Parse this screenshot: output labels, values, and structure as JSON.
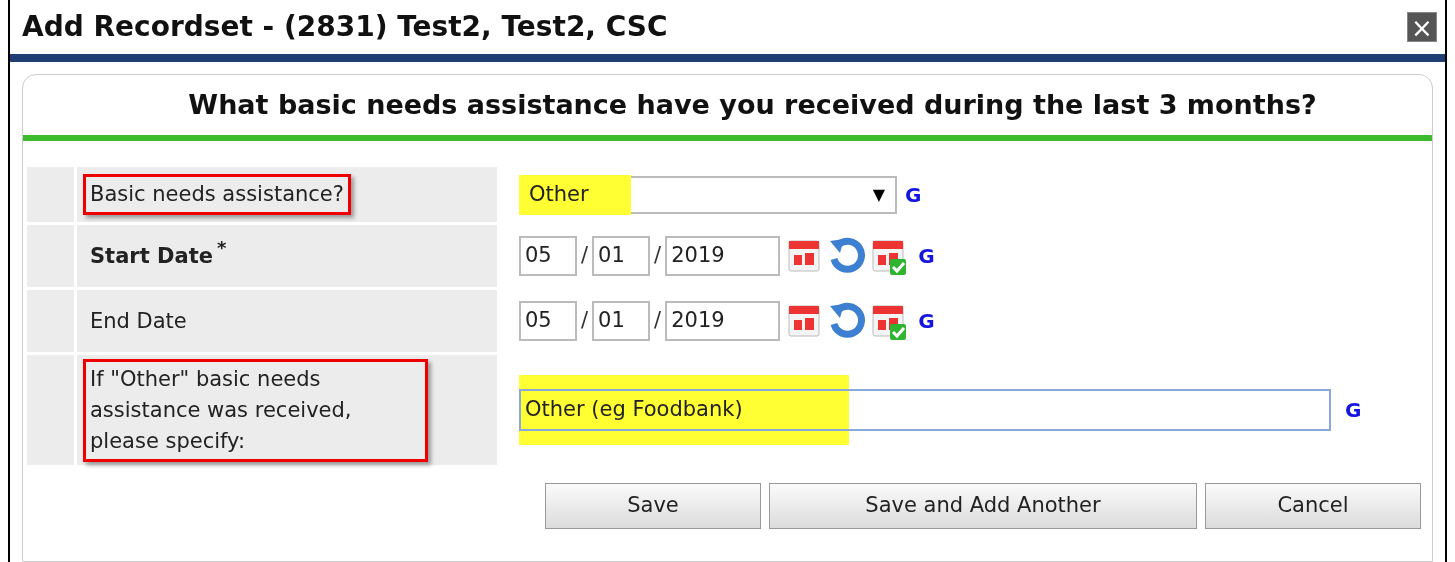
{
  "window": {
    "title": "Add Recordset - (2831) Test2, Test2, CSC",
    "close": "×"
  },
  "heading": "What basic needs assistance have you received during the last 3 months?",
  "rows": [
    {
      "kind": "select",
      "label": "Basic needs assistance?",
      "required": false,
      "outlined": true,
      "value": "Other",
      "highlighted": true,
      "arrow": "▼",
      "g": "G"
    },
    {
      "kind": "date",
      "label": "Start Date",
      "required": true,
      "required_mark": "*",
      "outlined": false,
      "month": "05",
      "day": "01",
      "year": "2019",
      "separators": [
        "/",
        "/"
      ],
      "g": "G"
    },
    {
      "kind": "date",
      "label": "End Date",
      "required": false,
      "outlined": false,
      "month": "05",
      "day": "01",
      "year": "2019",
      "separators": [
        "/",
        "/"
      ],
      "g": "G"
    },
    {
      "kind": "text",
      "label": "If \"Other\" basic needs assistance was received, please specify:",
      "required": false,
      "outlined": true,
      "value": "Other (eg Foodbank)",
      "highlighted": true,
      "g": "G"
    }
  ],
  "buttons": [
    "Save",
    "Save and Add Another",
    "Cancel"
  ]
}
